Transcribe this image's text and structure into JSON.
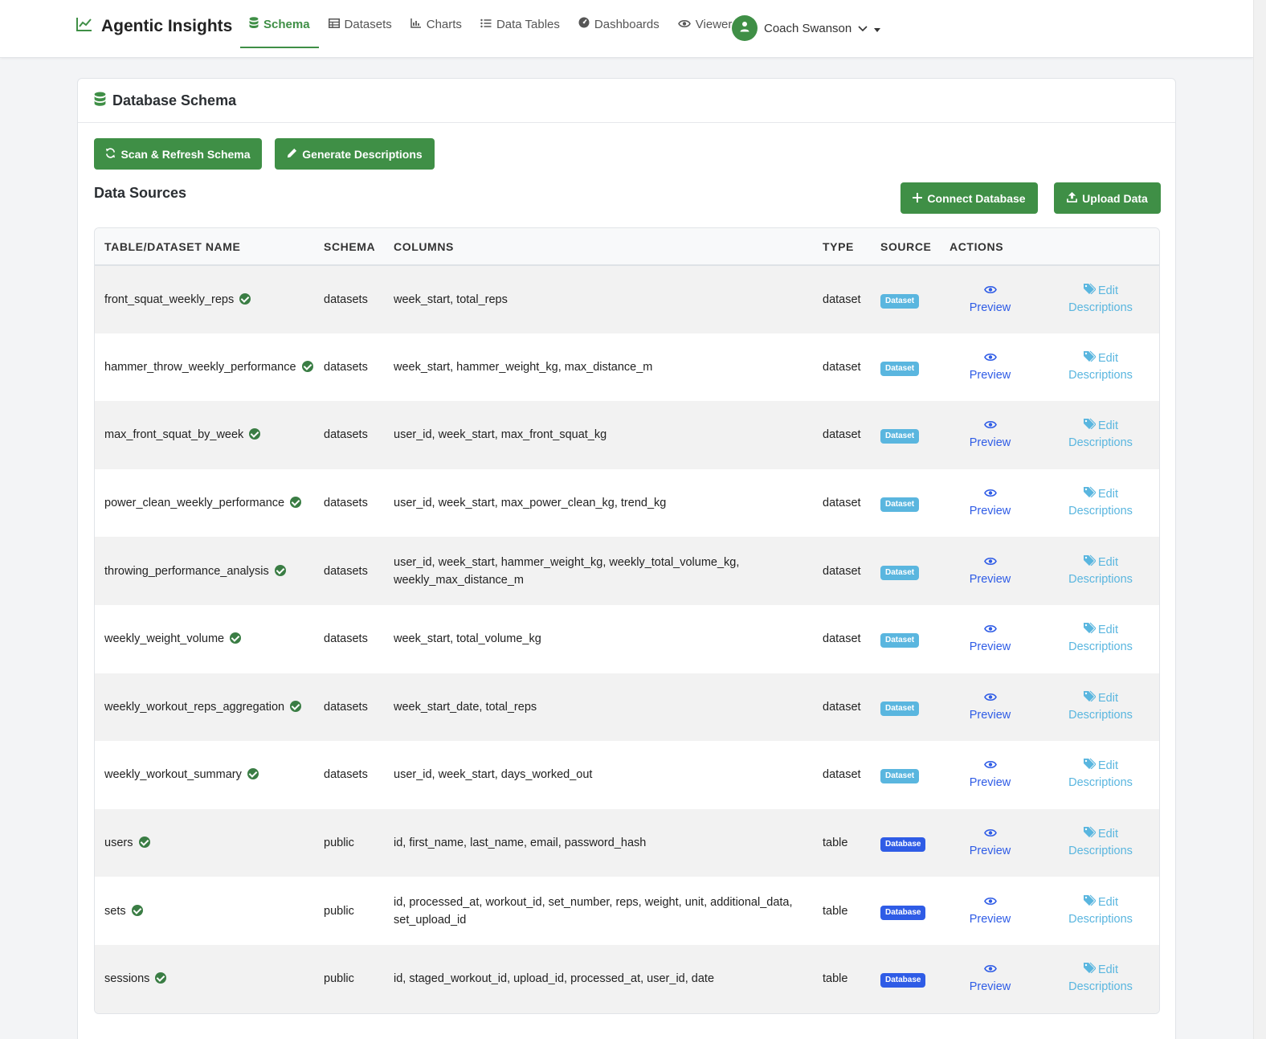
{
  "app": {
    "title": "Agentic Insights"
  },
  "nav": {
    "items": [
      {
        "label": "Schema",
        "icon": "database-icon",
        "active": true
      },
      {
        "label": "Datasets",
        "icon": "table-icon"
      },
      {
        "label": "Charts",
        "icon": "chart-icon"
      },
      {
        "label": "Data Tables",
        "icon": "list-icon"
      },
      {
        "label": "Dashboards",
        "icon": "gauge-icon"
      },
      {
        "label": "Viewer",
        "icon": "eye-icon"
      }
    ],
    "user": {
      "name": "Coach Swanson"
    }
  },
  "page": {
    "title": "Database Schema",
    "scan_button": "Scan & Refresh Schema",
    "generate_button": "Generate Descriptions",
    "section_title": "Data Sources",
    "connect_button": "Connect Database",
    "upload_button": "Upload Data"
  },
  "table": {
    "headers": [
      "TABLE/DATASET NAME",
      "SCHEMA",
      "COLUMNS",
      "TYPE",
      "SOURCE",
      "ACTIONS"
    ],
    "preview_label": "Preview",
    "edit_label_1": "Edit",
    "edit_label_2": "Descriptions",
    "rows": [
      {
        "name": "front_squat_weekly_reps",
        "schema": "datasets",
        "columns": "week_start, total_reps",
        "type": "dataset",
        "source": "Dataset"
      },
      {
        "name": "hammer_throw_weekly_performance",
        "schema": "datasets",
        "columns": "week_start, hammer_weight_kg, max_distance_m",
        "type": "dataset",
        "source": "Dataset"
      },
      {
        "name": "max_front_squat_by_week",
        "schema": "datasets",
        "columns": "user_id, week_start, max_front_squat_kg",
        "type": "dataset",
        "source": "Dataset"
      },
      {
        "name": "power_clean_weekly_performance",
        "schema": "datasets",
        "columns": "user_id, week_start, max_power_clean_kg, trend_kg",
        "type": "dataset",
        "source": "Dataset"
      },
      {
        "name": "throwing_performance_analysis",
        "schema": "datasets",
        "columns": "user_id, week_start, hammer_weight_kg, weekly_total_volume_kg, weekly_max_distance_m",
        "type": "dataset",
        "source": "Dataset"
      },
      {
        "name": "weekly_weight_volume",
        "schema": "datasets",
        "columns": "week_start, total_volume_kg",
        "type": "dataset",
        "source": "Dataset"
      },
      {
        "name": "weekly_workout_reps_aggregation",
        "schema": "datasets",
        "columns": "week_start_date, total_reps",
        "type": "dataset",
        "source": "Dataset"
      },
      {
        "name": "weekly_workout_summary",
        "schema": "datasets",
        "columns": "user_id, week_start, days_worked_out",
        "type": "dataset",
        "source": "Dataset"
      },
      {
        "name": "users",
        "schema": "public",
        "columns": "id, first_name, last_name, email, password_hash",
        "type": "table",
        "source": "Database"
      },
      {
        "name": "sets",
        "schema": "public",
        "columns": "id, processed_at, workout_id, set_number, reps, weight, unit, additional_data, set_upload_id",
        "type": "table",
        "source": "Database"
      },
      {
        "name": "sessions",
        "schema": "public",
        "columns": "id, staged_workout_id, upload_id, processed_at, user_id, date",
        "type": "table",
        "source": "Database"
      }
    ]
  },
  "colors": {
    "primary": "#3f8f46",
    "preview": "#2f5ce6",
    "dataset_badge": "#5ab6df",
    "database_badge": "#2f5ce6"
  }
}
